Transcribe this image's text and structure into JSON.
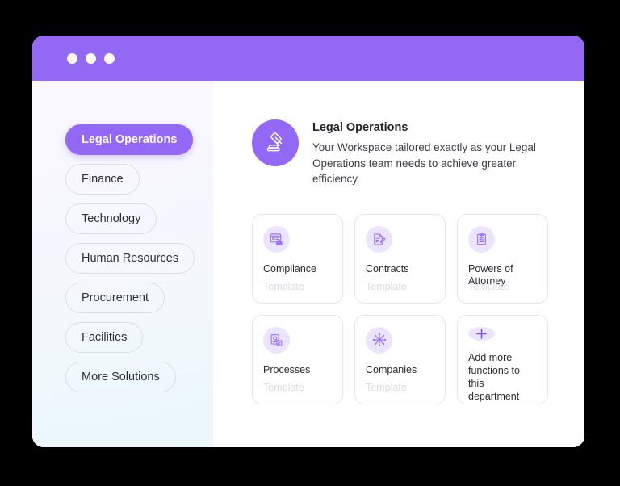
{
  "window": {
    "titlebar": {
      "dots": [
        "close-dot",
        "minimize-dot",
        "maximize-dot"
      ],
      "color": "#9268f5"
    }
  },
  "sidebar": {
    "items": [
      {
        "label": "Legal Operations",
        "active": true
      },
      {
        "label": "Finance",
        "active": false
      },
      {
        "label": "Technology",
        "active": false
      },
      {
        "label": "Human Resources",
        "active": false
      },
      {
        "label": "Procurement",
        "active": false
      },
      {
        "label": "Facilities",
        "active": false
      },
      {
        "label": "More Solutions",
        "active": false
      }
    ]
  },
  "department": {
    "icon": "gavel-icon",
    "title": "Legal Operations",
    "description": "Your Workspace tailored exactly as your Legal Operations team needs to achieve greater efficiency."
  },
  "cards": [
    {
      "icon": "compliance-report-icon",
      "title": "Compliance",
      "subtitle": "Template"
    },
    {
      "icon": "document-edit-icon",
      "title": "Contracts",
      "subtitle": "Template"
    },
    {
      "icon": "clipboard-checklist-icon",
      "title": "Powers of Attorney",
      "subtitle": "Template"
    },
    {
      "icon": "process-flow-icon",
      "title": "Processes",
      "subtitle": "Template"
    },
    {
      "icon": "network-hub-icon",
      "title": "Companies",
      "subtitle": "Template"
    },
    {
      "icon": "plus-icon",
      "title": "Add more functions to this department",
      "subtitle": ""
    }
  ],
  "colors": {
    "accent": "#9268f5",
    "accent_soft": "#ece4fd",
    "icon_purple": "#9a79f0",
    "card_border": "#e6e6ec",
    "muted_text": "#dbdbe3",
    "page_background": "#000000"
  }
}
